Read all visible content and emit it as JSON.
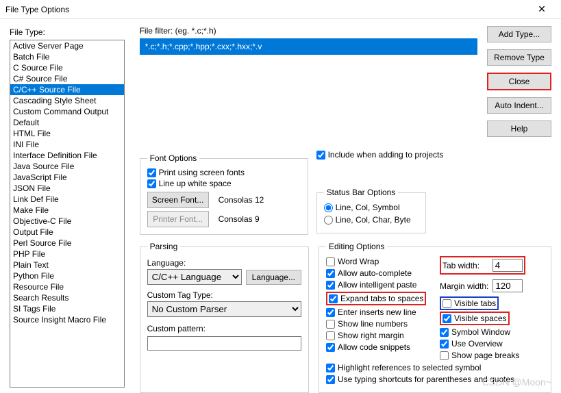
{
  "window": {
    "title": "File Type Options"
  },
  "left": {
    "label": "File Type:",
    "items": [
      "Active Server Page",
      "Batch File",
      "C Source File",
      "C# Source File",
      "C/C++ Source File",
      "Cascading Style Sheet",
      "Custom Command Output",
      "Default",
      "HTML File",
      "INI File",
      "Interface Definition File",
      "Java Source File",
      "JavaScript File",
      "JSON File",
      "Link Def File",
      "Make File",
      "Objective-C File",
      "Output File",
      "Perl Source File",
      "PHP File",
      "Plain Text",
      "Python File",
      "Resource File",
      "Search Results",
      "SI Tags File",
      "Source Insight Macro File"
    ],
    "selected_index": 4
  },
  "filter": {
    "label": "File filter: (eg. *.c;*.h)",
    "value": "*.c;*.h;*.cpp;*.hpp;*.cxx;*.hxx;*.v"
  },
  "buttons": {
    "add": "Add Type...",
    "remove": "Remove Type",
    "close": "Close",
    "auto_indent": "Auto Indent...",
    "help": "Help"
  },
  "font_options": {
    "legend": "Font Options",
    "print_screen_fonts": {
      "label": "Print using screen fonts",
      "checked": true
    },
    "lineup_ws": {
      "label": "Line up white space",
      "checked": true
    },
    "screen_font_btn": "Screen Font...",
    "printer_font_btn": "Printer Font...",
    "screen_font_value": "Consolas 12",
    "printer_font_value": "Consolas 9"
  },
  "include_proj": {
    "label": "Include when adding to projects",
    "checked": true
  },
  "status_bar": {
    "legend": "Status Bar Options",
    "opt1": "Line, Col, Symbol",
    "opt2": "Line, Col, Char, Byte",
    "selected": 0
  },
  "parsing": {
    "legend": "Parsing",
    "language_label": "Language:",
    "language_value": "C/C++ Language",
    "language_btn": "Language...",
    "custom_tag_label": "Custom Tag Type:",
    "custom_tag_value": "No Custom Parser",
    "custom_pattern_label": "Custom pattern:",
    "custom_pattern_value": ""
  },
  "editing": {
    "legend": "Editing Options",
    "word_wrap": {
      "label": "Word Wrap",
      "checked": false
    },
    "auto_complete": {
      "label": "Allow auto-complete",
      "checked": true
    },
    "intelligent_paste": {
      "label": "Allow intelligent paste",
      "checked": true
    },
    "expand_tabs": {
      "label": "Expand tabs to spaces",
      "checked": true
    },
    "enter_new_line": {
      "label": "Enter inserts new line",
      "checked": true
    },
    "show_line_numbers": {
      "label": "Show line numbers",
      "checked": false
    },
    "show_right_margin": {
      "label": "Show right margin",
      "checked": false
    },
    "code_snippets": {
      "label": "Allow code snippets",
      "checked": true
    },
    "highlight_refs": {
      "label": "Highlight references to selected symbol",
      "checked": true
    },
    "typing_shortcuts": {
      "label": "Use typing shortcuts for parentheses and quotes",
      "checked": true
    },
    "tab_width_label": "Tab width:",
    "tab_width_value": "4",
    "margin_width_label": "Margin width:",
    "margin_width_value": "120",
    "visible_tabs": {
      "label": "Visible tabs",
      "checked": false
    },
    "visible_spaces": {
      "label": "Visible spaces",
      "checked": true
    },
    "symbol_window": {
      "label": "Symbol Window",
      "checked": true
    },
    "use_overview": {
      "label": "Use Overview",
      "checked": true
    },
    "page_breaks": {
      "label": "Show page breaks",
      "checked": false
    }
  },
  "watermark": "CSDN @Moon~"
}
